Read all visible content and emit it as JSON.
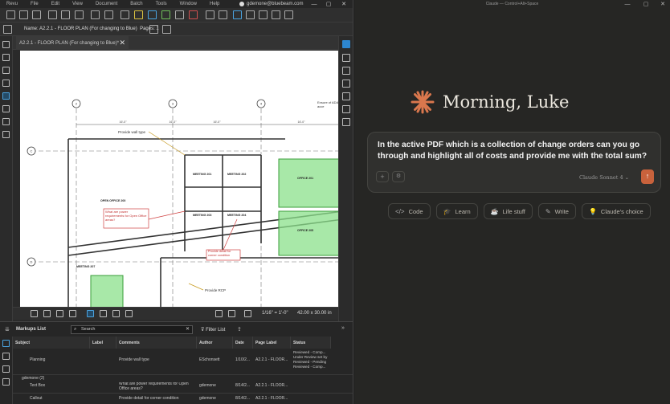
{
  "bluebeam": {
    "menu": [
      "Revu",
      "File",
      "Edit",
      "View",
      "Document",
      "Batch",
      "Tools",
      "Window",
      "Help"
    ],
    "account": "gdemone@bluebeam.com",
    "name_label": "Name: A2.2.1 - FLOOR PLAN (For changing to Blue)",
    "pages_label": "Pages: 1",
    "doc_tab": "A2.2.1 - FLOOR PLAN (For changing to Blue)*",
    "plan": {
      "callouts": [
        "Provide wall type",
        "Provide detail for corner condition",
        "Provide RCP",
        "What are power requirements for Open Office areas?",
        "Ensure of ADA acce"
      ],
      "rooms": [
        "MEETING 201",
        "MEETING 202",
        "MEETING 203",
        "MEETING 204",
        "OPEN OFFICE 200",
        "OFFICE 201",
        "OFFICE 205",
        "MEETING 207"
      ],
      "grid_numbers": [
        "2",
        "3",
        "4"
      ],
      "grid_letters": [
        "C",
        "D"
      ],
      "dim": "16'-0\""
    },
    "statusbar": {
      "scale": "1/16\" = 1'-0\"",
      "size": "42.00 x 30.00 in"
    },
    "markups": {
      "title": "Markups List",
      "search_placeholder": "Search",
      "filter": "Filter List",
      "columns": [
        "Subject",
        "Label",
        "Comments",
        "Author",
        "Date",
        "Page Label",
        "Status"
      ],
      "rows": [
        {
          "subject": "Planning",
          "label": "",
          "comments": "Provide wall type",
          "author": "ESchonsett",
          "date": "1/10/2...",
          "page": "A2.2.1 - FLOOR...",
          "status": "Reviewed - Comp... Under Review set by Reviewed - Pending Reviewed - Comp..."
        },
        {
          "subject": "gdemone (2)",
          "label": "",
          "comments": "",
          "author": "",
          "date": "",
          "page": "",
          "status": ""
        },
        {
          "subject": "Text Box",
          "label": "",
          "comments": "What are power requirements for Open Office areas?",
          "author": "gdemone",
          "date": "8/14/2...",
          "page": "A2.2.1 - FLOOR...",
          "status": ""
        },
        {
          "subject": "Callout",
          "label": "",
          "comments": "Provide detail for corner condition",
          "author": "gdemone",
          "date": "8/14/2...",
          "page": "A2.2.1 - FLOOR...",
          "status": ""
        }
      ]
    }
  },
  "claude": {
    "window_title": "Claude — Control+Alt+Space",
    "greeting": "Morning, Luke",
    "message": "In the active PDF which is a collection of change orders can you go through and highlight all of costs and provide me with the total sum?",
    "model": "Claude Sonnet 4",
    "chips": [
      {
        "icon": "</>",
        "label": "Code"
      },
      {
        "icon": "🎓",
        "label": "Learn"
      },
      {
        "icon": "☕",
        "label": "Life stuff"
      },
      {
        "icon": "✎",
        "label": "Write"
      },
      {
        "icon": "💡",
        "label": "Claude's choice"
      }
    ],
    "accent": "#c8623c"
  }
}
